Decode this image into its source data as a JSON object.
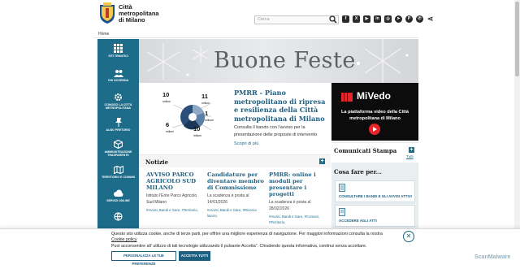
{
  "header": {
    "brand_lines": [
      "Città",
      "metropolitana",
      "di Milano"
    ],
    "search_placeholder": "Cerca",
    "socials": [
      {
        "icon": "facebook-icon",
        "glyph": "f"
      },
      {
        "icon": "x-icon",
        "glyph": "X"
      },
      {
        "icon": "youtube-icon",
        "glyph": "▶"
      },
      {
        "icon": "linkedin-icon",
        "glyph": "in"
      },
      {
        "icon": "instagram-icon",
        "glyph": "◎"
      },
      {
        "icon": "telegram-icon",
        "glyph": "➤"
      },
      {
        "icon": "pinterest-icon",
        "glyph": "P"
      },
      {
        "icon": "whatsapp-icon",
        "glyph": "✆"
      }
    ]
  },
  "breadcrumb": "Home",
  "sidebar": {
    "items": [
      {
        "label": "Siti tematici",
        "icon": "grid-icon"
      },
      {
        "label": "Chi governa",
        "icon": "people-icon"
      },
      {
        "label": "Conosci la Città metropolitana",
        "icon": "gear-icon"
      },
      {
        "label": "Albo pretorio",
        "icon": "pin-icon"
      },
      {
        "label": "Amministrazione trasparente",
        "icon": "cube-icon"
      },
      {
        "label": "Territorio e Comuni",
        "icon": "map-icon"
      },
      {
        "label": "Servizi online",
        "icon": "cloud-icon"
      }
    ]
  },
  "banner": {
    "title": "Buone Feste"
  },
  "pnrr": {
    "title": "PMRR - Piano metropolitano di ripresa e resilienza della Città metropolitana di Milano",
    "desc": "Consulta il bando con l'avviso per la presentazione delle proposte di intervento",
    "link": "Scopri di più",
    "image_labels": {
      "top_left": "10",
      "top_left_unit": "milioni",
      "top_right": "11",
      "top_right_unit": "milioni",
      "mid_right": "1",
      "mid_right_unit": "milione",
      "bottom_left": "6",
      "bottom_left_unit": "milioni",
      "bottom_right": "10",
      "bottom_right_unit": "milioni"
    }
  },
  "mivedo": {
    "name": "MiVedo",
    "desc": "La piattaforma video della Città metropolitana di Milano"
  },
  "comunicati": {
    "title": "Comunicati Stampa",
    "all_link": "Tutti"
  },
  "cosa_fare": {
    "title": "Cosa fare per...",
    "items": [
      {
        "label": "Consultare i bandi e gli avvisi attivi",
        "icon": "document-icon"
      },
      {
        "label": "Accedere agli atti",
        "icon": "folder-icon"
      }
    ]
  },
  "notizie": {
    "title": "Notizie",
    "items": [
      {
        "title": "AVVISO PARCO AGRICOLO SUD MILANO",
        "body": "Istituto l'Ente Parco Agricolo Sud Milano",
        "tags": "#Avvisi, Bandi e Gare, #Territorio,"
      },
      {
        "title": "Candidature per diventare membro di Commissione",
        "body": "La scadenza è posta al 14/01/2026",
        "tags": "#Avvisi, Bandi e Gare, #Ricerca lavoro,"
      },
      {
        "title": "PMRR: online i moduli per presentare i progetti",
        "body": "La scadenza è posta al 28/02/2026",
        "tags": "#Avvisi, Bandi e Gare, #Comuni, #Territorio,"
      }
    ]
  },
  "cookie": {
    "text1": "Questo sito utilizza cookie, anche di terze parti, per offrire una migliore esperienza di navigazione. Per maggiori informazioni consulta la nostra",
    "link": "Cookie policy",
    "text2": "Puoi acconsentire all' utilizzo di tali tecnologie utilizzando il pulsante Accetta\". Chiudendo questa informativa, continui senza accettare.",
    "btn_customize": "Personalizza le tue preferenze",
    "btn_accept": "Accetta tutti",
    "close": "✕"
  },
  "watermark": "ScanMalware",
  "colors": {
    "accent": "#1d6c8a",
    "dark_accent": "#1d5f80",
    "mivedo_bg": "#0c0c0c",
    "play_red": "#e2262a"
  }
}
